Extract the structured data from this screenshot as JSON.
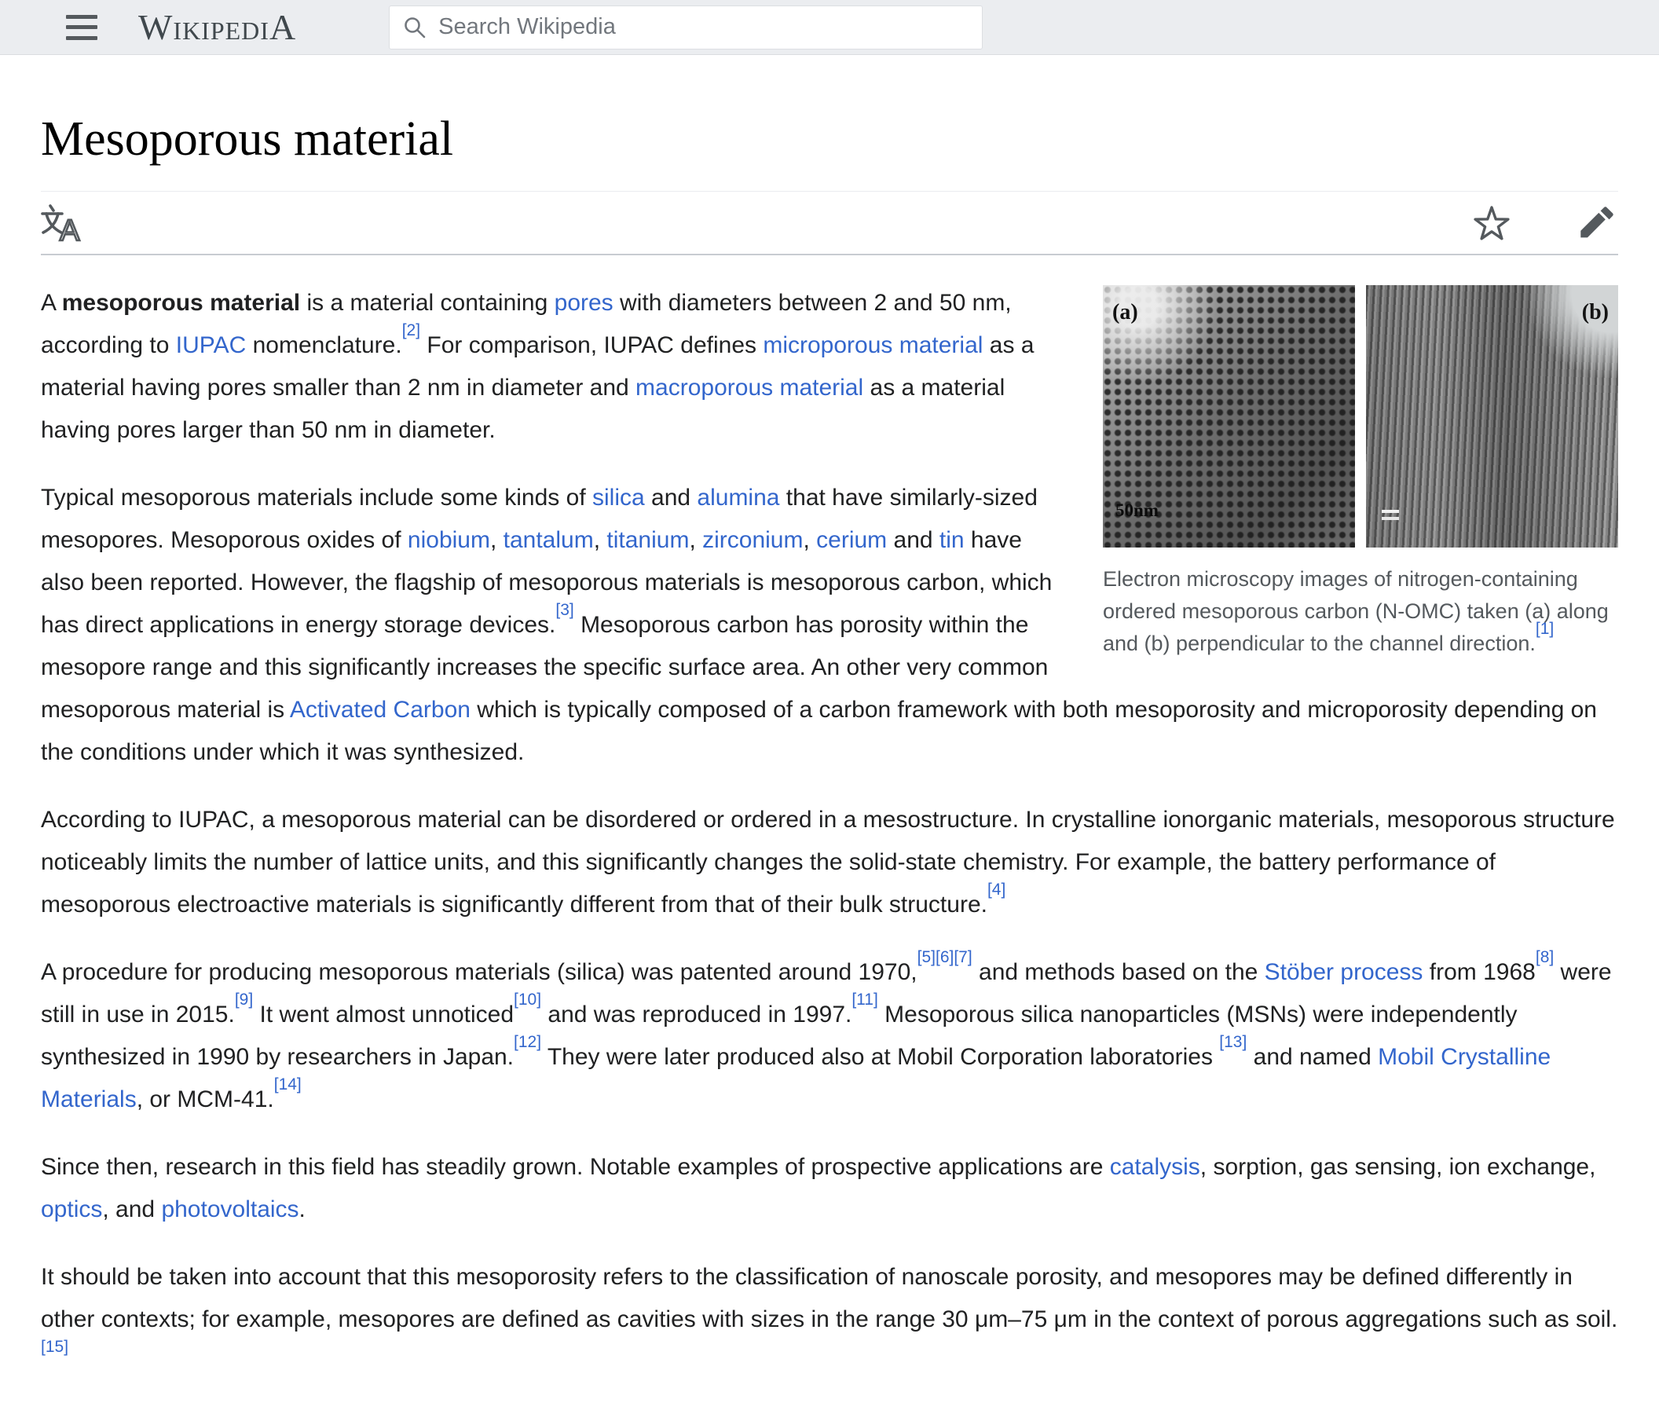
{
  "header": {
    "wordmark": "WikipediA",
    "search": {
      "placeholder": "Search Wikipedia"
    },
    "icons": {
      "menu": "hamburger-menu-icon",
      "search": "search-icon"
    }
  },
  "toolbar": {
    "icons": {
      "language": "language-icon",
      "watch": "star-icon",
      "edit": "pencil-icon"
    }
  },
  "article": {
    "title": "Mesoporous material",
    "figure": {
      "label_a": "(a)",
      "label_b": "(b)",
      "scale_label": "50nm",
      "caption_runs": [
        {
          "t": "Electron microscopy images of nitrogen-containing ordered mesoporous carbon (N-OMC) taken (a) along and (b) perpendicular to the channel direction."
        },
        {
          "sup": "[1]"
        }
      ]
    },
    "paragraphs": [
      {
        "runs": [
          {
            "t": "A "
          },
          {
            "b": "mesoporous material"
          },
          {
            "t": " is a material containing "
          },
          {
            "a": "pores"
          },
          {
            "t": " with diameters between 2 and 50 nm, according to "
          },
          {
            "a": "IUPAC"
          },
          {
            "t": " nomenclature."
          },
          {
            "sup": "[2]"
          },
          {
            "t": " For comparison, IUPAC defines "
          },
          {
            "a": "microporous material"
          },
          {
            "t": " as a material having pores smaller than 2 nm in diameter and "
          },
          {
            "a": "macroporous material"
          },
          {
            "t": " as a material having pores larger than 50 nm in diameter."
          }
        ]
      },
      {
        "runs": [
          {
            "t": "Typical mesoporous materials include some kinds of "
          },
          {
            "a": "silica"
          },
          {
            "t": " and "
          },
          {
            "a": "alumina"
          },
          {
            "t": " that have similarly-sized mesopores. Mesoporous oxides of "
          },
          {
            "a": "niobium"
          },
          {
            "t": ", "
          },
          {
            "a": "tantalum"
          },
          {
            "t": ", "
          },
          {
            "a": "titanium"
          },
          {
            "t": ", "
          },
          {
            "a": "zirconium"
          },
          {
            "t": ", "
          },
          {
            "a": "cerium"
          },
          {
            "t": " and "
          },
          {
            "a": "tin"
          },
          {
            "t": " have also been reported. However, the flagship of mesoporous materials is mesoporous carbon, which has direct applications in energy storage devices."
          },
          {
            "sup": "[3]"
          },
          {
            "t": " Mesoporous carbon has porosity within the mesopore range and this significantly increases the specific surface area. An other very common mesoporous material is "
          },
          {
            "a": "Activated Carbon"
          },
          {
            "t": " which is typically composed of a carbon framework with both mesoporosity and microporosity depending on the conditions under which it was synthesized."
          }
        ]
      },
      {
        "runs": [
          {
            "t": "According to IUPAC, a mesoporous material can be disordered or ordered in a mesostructure. In crystalline ionorganic materials, mesoporous structure noticeably limits the number of lattice units, and this significantly changes the solid-state chemistry. For example, the battery performance of mesoporous electroactive materials is significantly different from that of their bulk structure."
          },
          {
            "sup": "[4]"
          }
        ]
      },
      {
        "runs": [
          {
            "t": "A procedure for producing mesoporous materials (silica) was patented around 1970,"
          },
          {
            "sup": "[5]"
          },
          {
            "sup": "[6]"
          },
          {
            "sup": "[7]"
          },
          {
            "t": " and methods based on the "
          },
          {
            "a": "Stöber process"
          },
          {
            "t": " from 1968"
          },
          {
            "sup": "[8]"
          },
          {
            "t": " were still in use in 2015."
          },
          {
            "sup": "[9]"
          },
          {
            "t": " It went almost unnoticed"
          },
          {
            "sup": "[10]"
          },
          {
            "t": " and was reproduced in 1997."
          },
          {
            "sup": "[11]"
          },
          {
            "t": " Mesoporous silica nanoparticles (MSNs) were independently synthesized in 1990 by researchers in Japan."
          },
          {
            "sup": "[12]"
          },
          {
            "t": " They were later produced also at Mobil Corporation laboratories "
          },
          {
            "sup": "[13]"
          },
          {
            "t": " and named "
          },
          {
            "a": "Mobil Crystalline Materials"
          },
          {
            "t": ", or MCM-41."
          },
          {
            "sup": "[14]"
          }
        ]
      },
      {
        "runs": [
          {
            "t": "Since then, research in this field has steadily grown. Notable examples of prospective applications are "
          },
          {
            "a": "catalysis"
          },
          {
            "t": ", sorption, gas sensing, ion exchange, "
          },
          {
            "a": "optics"
          },
          {
            "t": ", and "
          },
          {
            "a": "photovoltaics"
          },
          {
            "t": "."
          }
        ]
      },
      {
        "runs": [
          {
            "t": "It should be taken into account that this mesoporosity refers to the classification of nanoscale porosity, and mesopores may be defined differently in other contexts; for example, mesopores are defined as cavities with sizes in the range 30 μm–75 μm in the context of porous aggregations such as soil."
          },
          {
            "sup": "[15]"
          }
        ]
      }
    ]
  },
  "colors": {
    "link": "#3366cc",
    "text": "#202122",
    "muted": "#54595d",
    "header_bg": "#ebedf0"
  }
}
